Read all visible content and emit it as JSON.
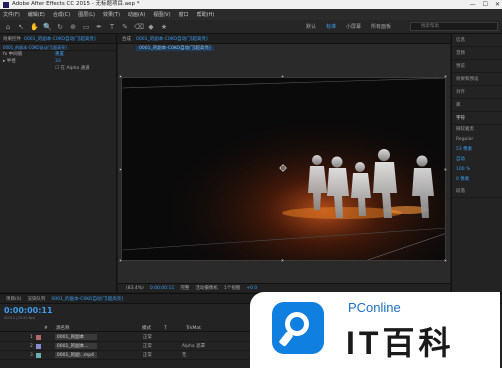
{
  "window": {
    "title": "Adobe After Effects CC 2015 - 无标题项目.aep *",
    "controls": [
      "—",
      "☐",
      "✕"
    ]
  },
  "menu": [
    "文件(F)",
    "编辑(E)",
    "合成(C)",
    "图层(L)",
    "效果(T)",
    "动画(A)",
    "视图(V)",
    "窗口",
    "帮助(H)"
  ],
  "toolbar": {
    "tools": [
      "⌂",
      "↖",
      "✋",
      "🔍",
      "↻",
      "⊕",
      "▭",
      "✒",
      "T",
      "✎",
      "⌫",
      "◆",
      "★"
    ],
    "workspaces": [
      "默认",
      "标准",
      "小屏幕",
      "所有面板"
    ],
    "active_workspace": "标准",
    "search_placeholder": "搜索帮助"
  },
  "effect_controls": {
    "tab_label": "效果控件",
    "tab_target": "0001_的副本-C0KO自动门[超高亮]",
    "sub_label": "0001_的副本-C0KO自动门[超高亮]",
    "rows": [
      {
        "label": "fx 中间值",
        "value": "重置"
      },
      {
        "label": "▸ 半径",
        "value": "33"
      },
      {
        "label": "",
        "value": "☐ 在 Alpha 通道"
      }
    ]
  },
  "composition": {
    "tab_label": "合成",
    "tab_name": "0001_的副本-C0KO自动门[超高亮]",
    "breadcrumb": "0001_的副本-C0KO自动门[超高亮]",
    "zoom": "(83.4%)",
    "timecode": "0:00:00:11",
    "resolution": "完整",
    "camera": "活动摄像机",
    "views": "1个视图",
    "offset": "+0.0"
  },
  "right_panel": {
    "items": [
      "信息",
      "音频",
      "预览",
      "效果和预设",
      "对齐",
      "库"
    ],
    "character_label": "字符",
    "paragraph_label": "段落",
    "font": "微软雅黑",
    "style": "Regular",
    "size": "53 像素",
    "leading": "自动",
    "tracking": "100 %",
    "baseline": "0 像素"
  },
  "timeline": {
    "tabs": [
      "项目(0)",
      "渲染队列",
      "0001_的副本-C0KO自动门[超高亮]"
    ],
    "active_tab": "0001_的副本-C0KO自动门[超高亮]",
    "current_time": "0:00:00:11",
    "fps_note": "00011 (25.00 fps)",
    "columns": [
      "#",
      "源名称",
      "模式",
      "T",
      "TrkMat"
    ],
    "layers": [
      {
        "index": "1",
        "name": "0001_的副本",
        "color": "#b06a6a",
        "mode": "正常",
        "trkmat": ""
      },
      {
        "index": "2",
        "name": "0001_的副本...",
        "color": "#8a8ad0",
        "mode": "正常",
        "trkmat": "Alpha 遮罩"
      },
      {
        "index": "3",
        "name": "0001_的副...mp4",
        "color": "#6ab0b0",
        "mode": "正常",
        "trkmat": "无"
      }
    ]
  },
  "watermark": {
    "brand": "PConline",
    "title": "IT百科"
  }
}
